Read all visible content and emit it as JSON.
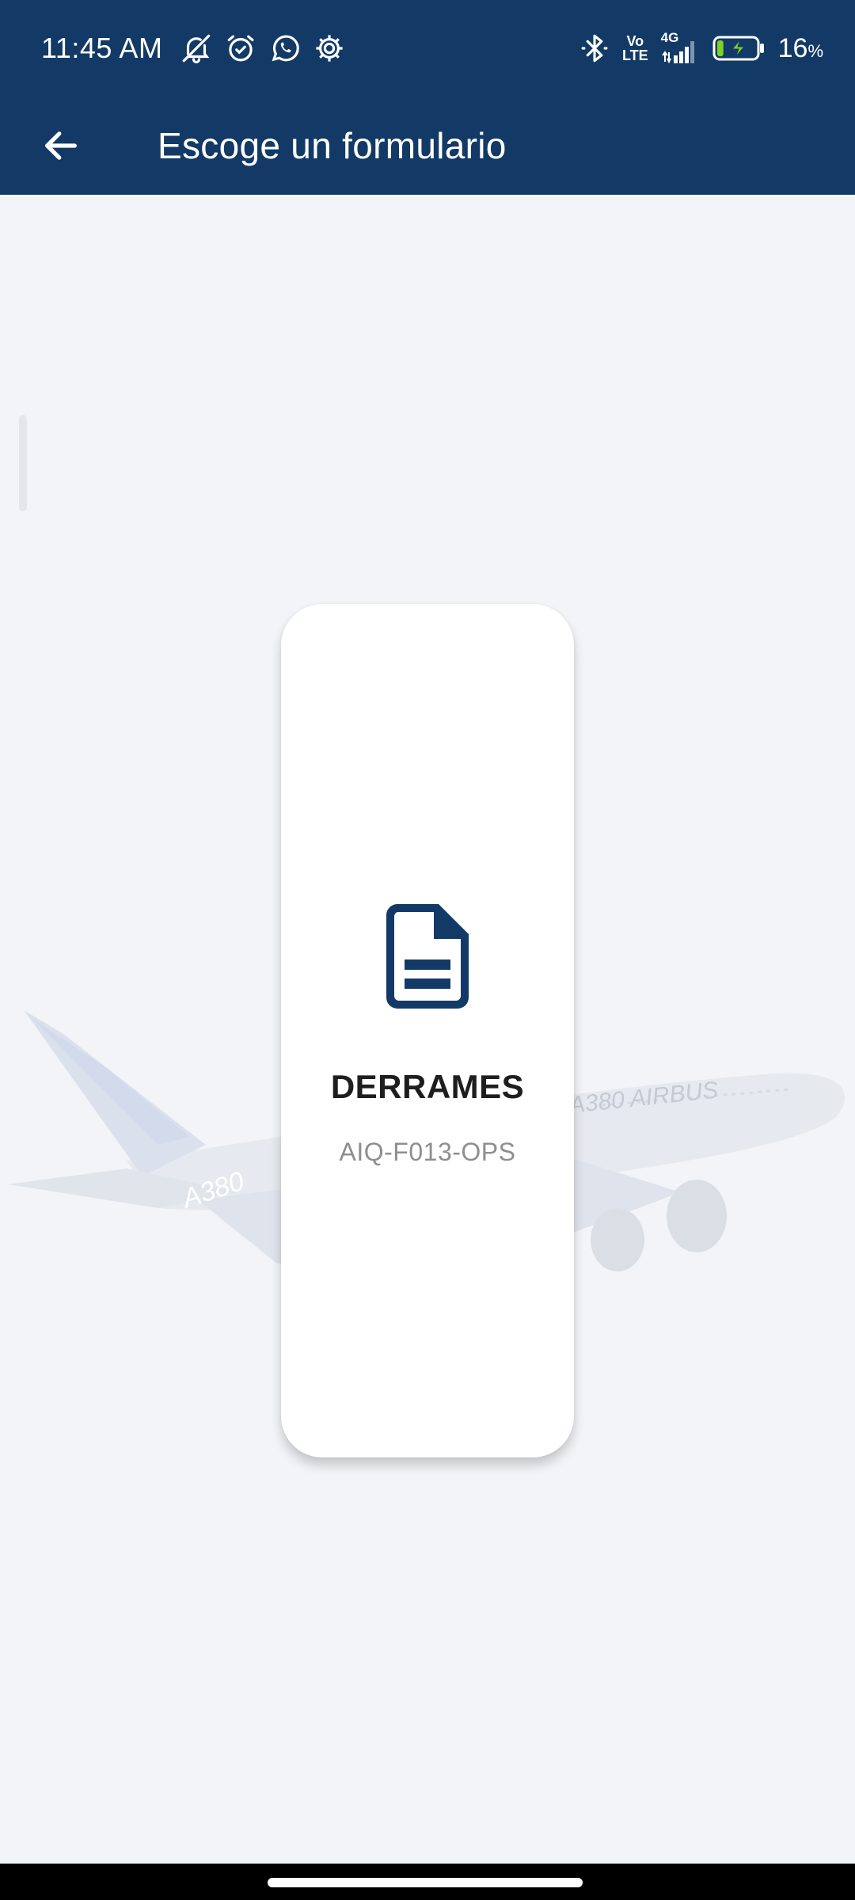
{
  "status_bar": {
    "time": "11:45 AM",
    "left_icons": [
      "muted-notifications-icon",
      "alarm-icon",
      "whatsapp-icon",
      "settings-gear-icon"
    ],
    "right_icons": [
      "bluetooth-icon",
      "volte-icon",
      "signal-4g-icon",
      "battery-charging-icon"
    ],
    "volte_top": "Vo",
    "volte_bottom": "LTE",
    "network_label": "4G",
    "battery_percent": "16",
    "battery_unit": "%",
    "battery_level": 0.16,
    "battery_color": "#7ed321"
  },
  "app_bar": {
    "back_icon": "arrow-back-icon",
    "title": "Escoge un formulario",
    "background": "#133a66"
  },
  "form_card": {
    "icon": "document-icon",
    "icon_color": "#133a66",
    "name": "DERRAMES",
    "code": "AIQ-F013-OPS"
  },
  "background_image": {
    "type": "airplane-watermark",
    "visible_text": [
      "A380",
      "A380 AIRBUS"
    ]
  }
}
